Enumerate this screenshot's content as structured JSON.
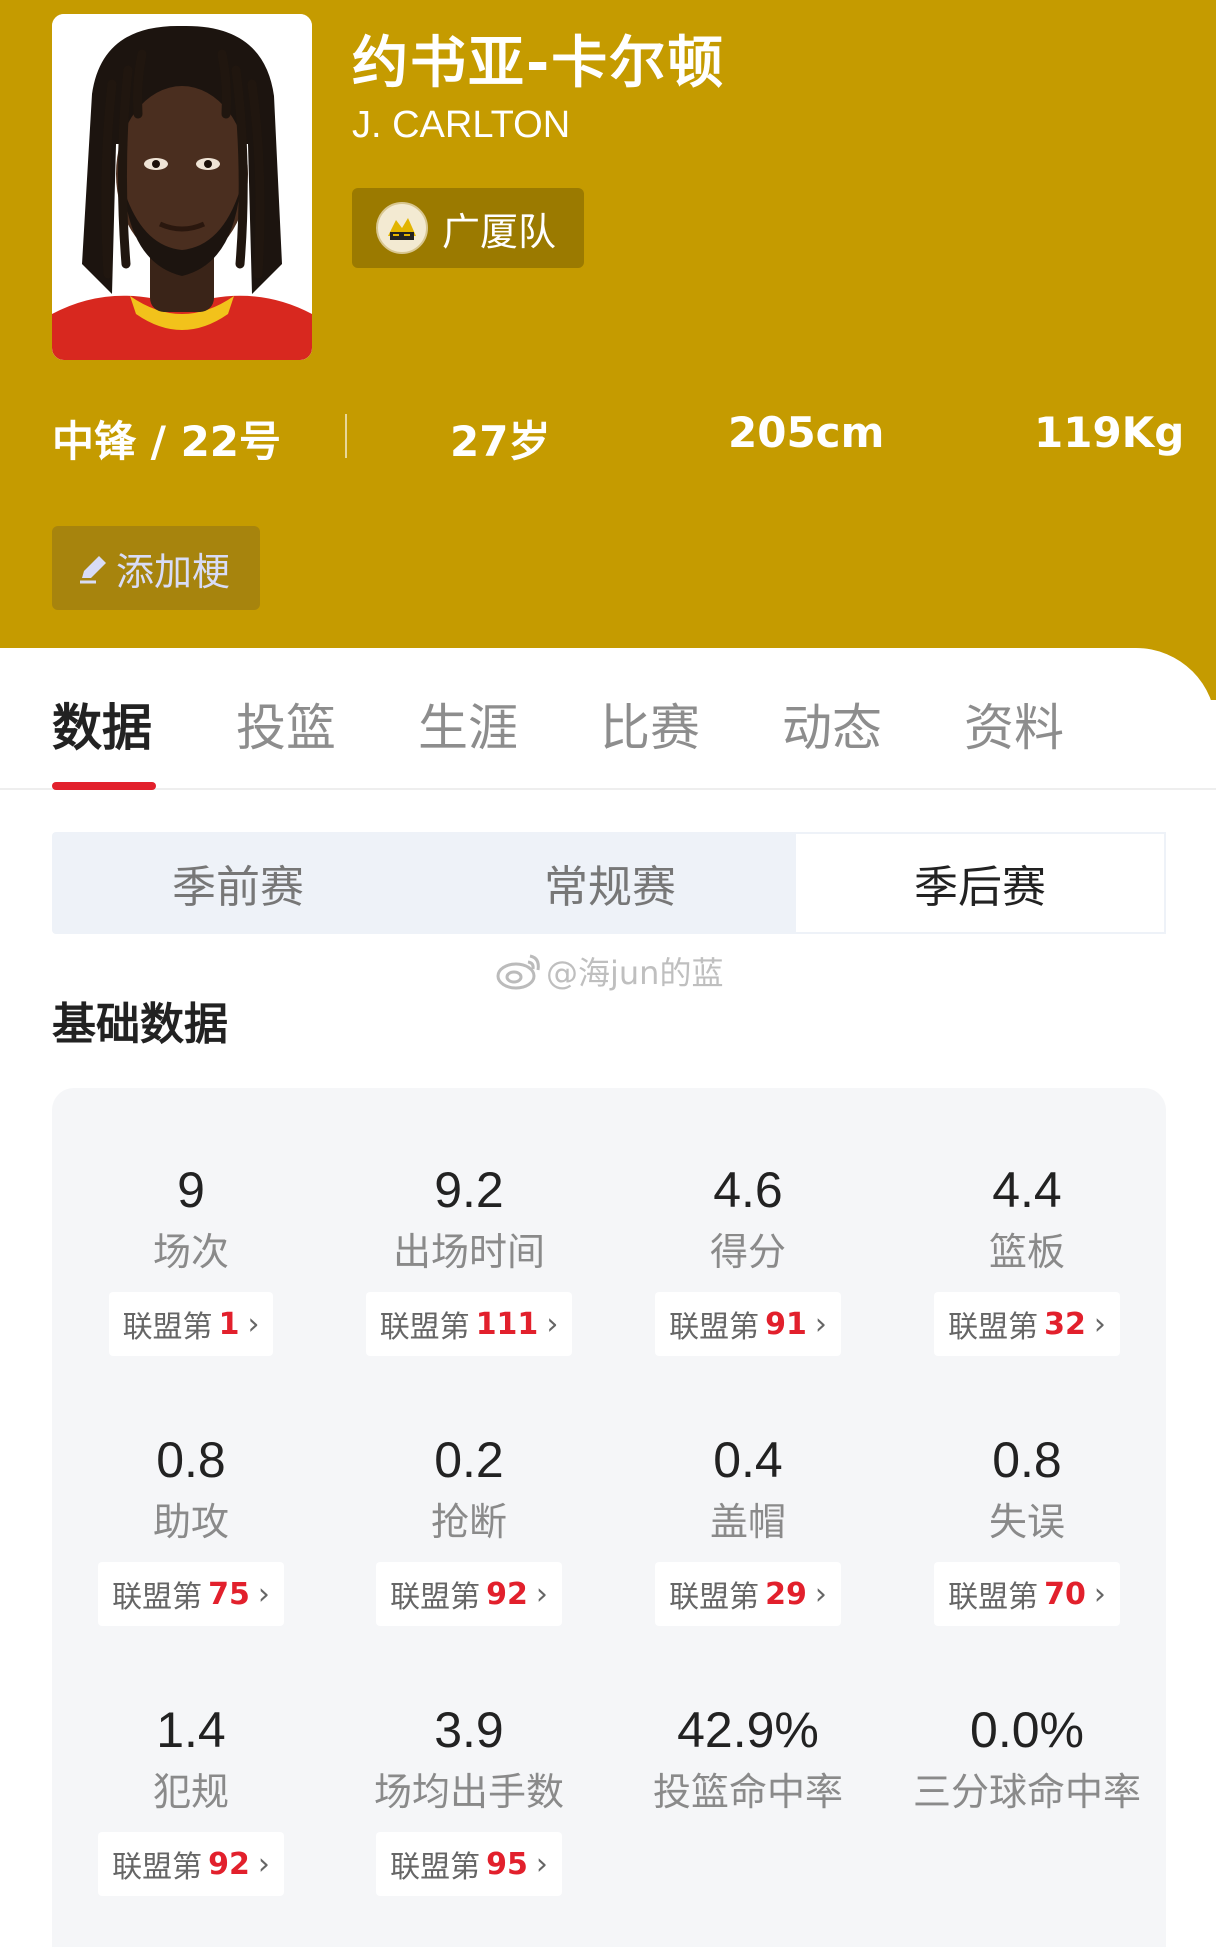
{
  "player": {
    "name_cn": "约书亚-卡尔顿",
    "name_en": "J. CARLTON",
    "team": "广厦队",
    "position_number": "中锋 / 22号",
    "age": "27岁",
    "height": "205cm",
    "weight": "119Kg"
  },
  "add_meme_label": "添加梗",
  "tabs": [
    "数据",
    "投篮",
    "生涯",
    "比赛",
    "动态",
    "资料"
  ],
  "season_types": [
    "季前赛",
    "常规赛",
    "季后赛"
  ],
  "selected_season_type": "季后赛",
  "watermark": "@海jun的蓝",
  "section_title": "基础数据",
  "rank_prefix": "联盟第",
  "stats": [
    {
      "value": "9",
      "label": "场次",
      "rank": "1"
    },
    {
      "value": "9.2",
      "label": "出场时间",
      "rank": "111"
    },
    {
      "value": "4.6",
      "label": "得分",
      "rank": "91"
    },
    {
      "value": "4.4",
      "label": "篮板",
      "rank": "32"
    },
    {
      "value": "0.8",
      "label": "助攻",
      "rank": "75"
    },
    {
      "value": "0.2",
      "label": "抢断",
      "rank": "92"
    },
    {
      "value": "0.4",
      "label": "盖帽",
      "rank": "29"
    },
    {
      "value": "0.8",
      "label": "失误",
      "rank": "70"
    },
    {
      "value": "1.4",
      "label": "犯规",
      "rank": "92"
    },
    {
      "value": "3.9",
      "label": "场均出手数",
      "rank": "95"
    },
    {
      "value": "42.9%",
      "label": "投篮命中率"
    },
    {
      "value": "0.0%",
      "label": "三分球命中率"
    }
  ],
  "colors": {
    "header_bg": "#C59B00",
    "accent_red": "#E2202C",
    "panel_bg": "#f5f6f8"
  },
  "icons": {
    "edit": "pencil-icon",
    "chevron": "chevron-right-icon",
    "team_logo": "zhejiang-team-logo",
    "watermark": "weibo-icon"
  }
}
